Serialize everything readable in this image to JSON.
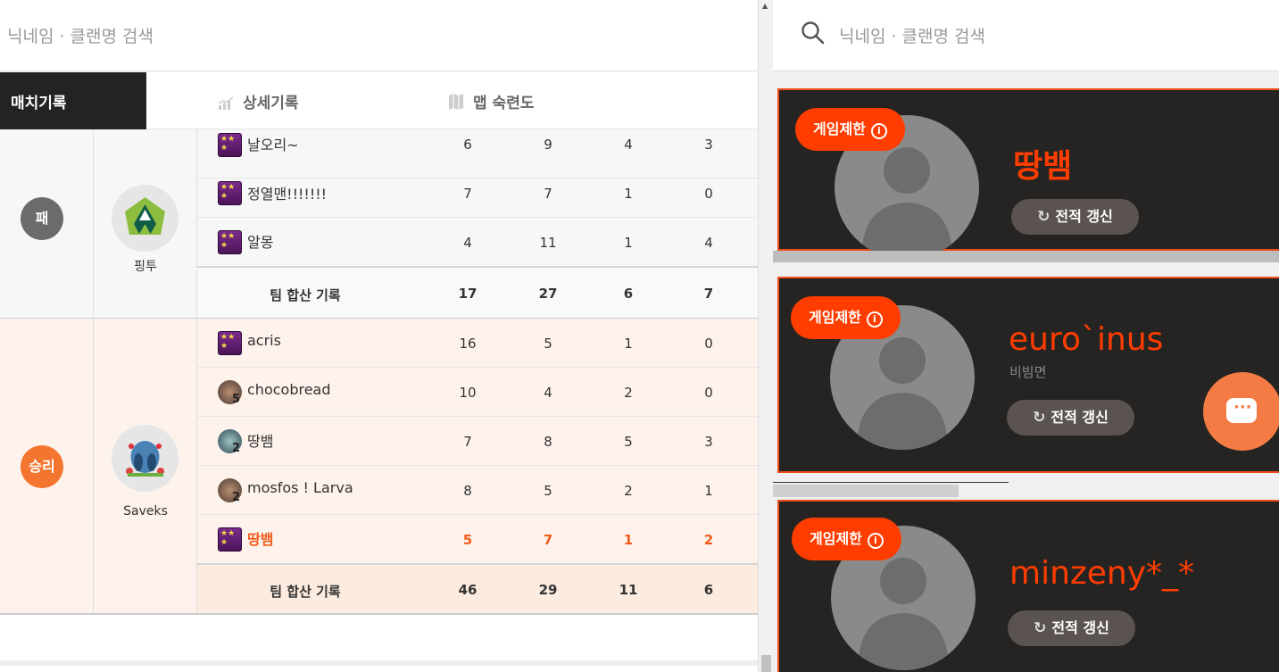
{
  "search_placeholder": "닉네임 · 클랜명 검색",
  "tabs": {
    "match": "매치기록",
    "detail": "상세기록",
    "map": "맵 숙련도"
  },
  "teams": [
    {
      "result": "패",
      "clan": "핑투",
      "players": [
        {
          "name": "날오리~",
          "rank_icon": "purple-rank-icon",
          "v": [
            "6",
            "9",
            "4",
            "3"
          ]
        },
        {
          "name": "정열맨!!!!!!!",
          "rank_icon": "purple-rank-icon",
          "v": [
            "7",
            "7",
            "1",
            "0"
          ]
        },
        {
          "name": "알몽",
          "rank_icon": "purple-rank-icon",
          "v": [
            "4",
            "11",
            "1",
            "4"
          ]
        }
      ],
      "total_label": "팀 합산 기록",
      "total": [
        "17",
        "27",
        "6",
        "7"
      ]
    },
    {
      "result": "승리",
      "clan": "Saveks",
      "players": [
        {
          "name": "acris",
          "rank_icon": "purple-rank-icon",
          "v": [
            "16",
            "5",
            "1",
            "0"
          ]
        },
        {
          "name": "chocobread",
          "rank_icon": "brown-rank-icon",
          "rank_num": "5",
          "v": [
            "10",
            "4",
            "2",
            "0"
          ]
        },
        {
          "name": "땅뱀",
          "rank_icon": "teal-rank-icon",
          "rank_num": "2",
          "v": [
            "7",
            "8",
            "5",
            "3"
          ]
        },
        {
          "name": "mosfos ! Larva",
          "rank_icon": "brown-rank-icon",
          "rank_num": "2",
          "v": [
            "8",
            "5",
            "2",
            "1"
          ]
        },
        {
          "name": "땅뱀",
          "rank_icon": "purple-rank-icon",
          "highlight": true,
          "v": [
            "5",
            "7",
            "1",
            "2"
          ]
        }
      ],
      "total_label": "팀 합산 기록",
      "total": [
        "46",
        "29",
        "11",
        "6"
      ]
    }
  ],
  "cards": [
    {
      "restrict": "게임제한",
      "name": "땅뱀",
      "clan": "",
      "refresh": "전적 갱신"
    },
    {
      "restrict": "게임제한",
      "name": "euro`inus",
      "clan": "비빔면",
      "refresh": "전적 갱신"
    },
    {
      "restrict": "게임제한",
      "name": "minzeny*_*",
      "clan": "",
      "refresh": "전적 갱신"
    }
  ],
  "colors": {
    "accent": "#ff3d00",
    "tab_active_bg": "#232323",
    "win_badge": "#f4752f",
    "lose_badge": "#6b6b6b",
    "card_bg": "#262422",
    "chat_button": "#f57b44"
  },
  "icons": {
    "search": "search-icon",
    "detail_tab": "bar-chart-icon",
    "map_tab": "map-icon",
    "restrict_info": "info-icon",
    "refresh": "refresh-icon",
    "chat": "chat-icon"
  }
}
